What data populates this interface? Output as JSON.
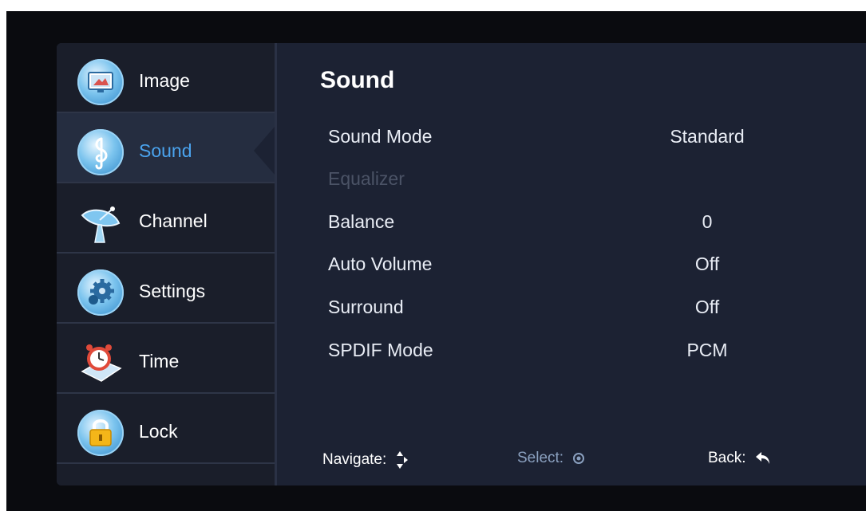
{
  "sidebar": {
    "items": [
      {
        "label": "Image",
        "icon": "tv-icon"
      },
      {
        "label": "Sound",
        "icon": "music-note-icon"
      },
      {
        "label": "Channel",
        "icon": "satellite-dish-icon"
      },
      {
        "label": "Settings",
        "icon": "gear-icon"
      },
      {
        "label": "Time",
        "icon": "alarm-clock-icon"
      },
      {
        "label": "Lock",
        "icon": "lock-icon"
      }
    ],
    "active_index": 1
  },
  "panel": {
    "title": "Sound",
    "rows": [
      {
        "label": "Sound Mode",
        "value": "Standard",
        "disabled": false
      },
      {
        "label": "Equalizer",
        "value": "",
        "disabled": true
      },
      {
        "label": "Balance",
        "value": "0",
        "disabled": false
      },
      {
        "label": "Auto Volume",
        "value": "Off",
        "disabled": false
      },
      {
        "label": "Surround",
        "value": "Off",
        "disabled": false
      },
      {
        "label": "SPDIF Mode",
        "value": "PCM",
        "disabled": false
      }
    ]
  },
  "footer": {
    "navigate": "Navigate:",
    "select": "Select:",
    "back": "Back:"
  },
  "colors": {
    "accent": "#4aa3ee",
    "panel_bg": "#1c2233",
    "sidebar_bg": "#1a1e2a",
    "disabled_text": "#4b5366"
  }
}
